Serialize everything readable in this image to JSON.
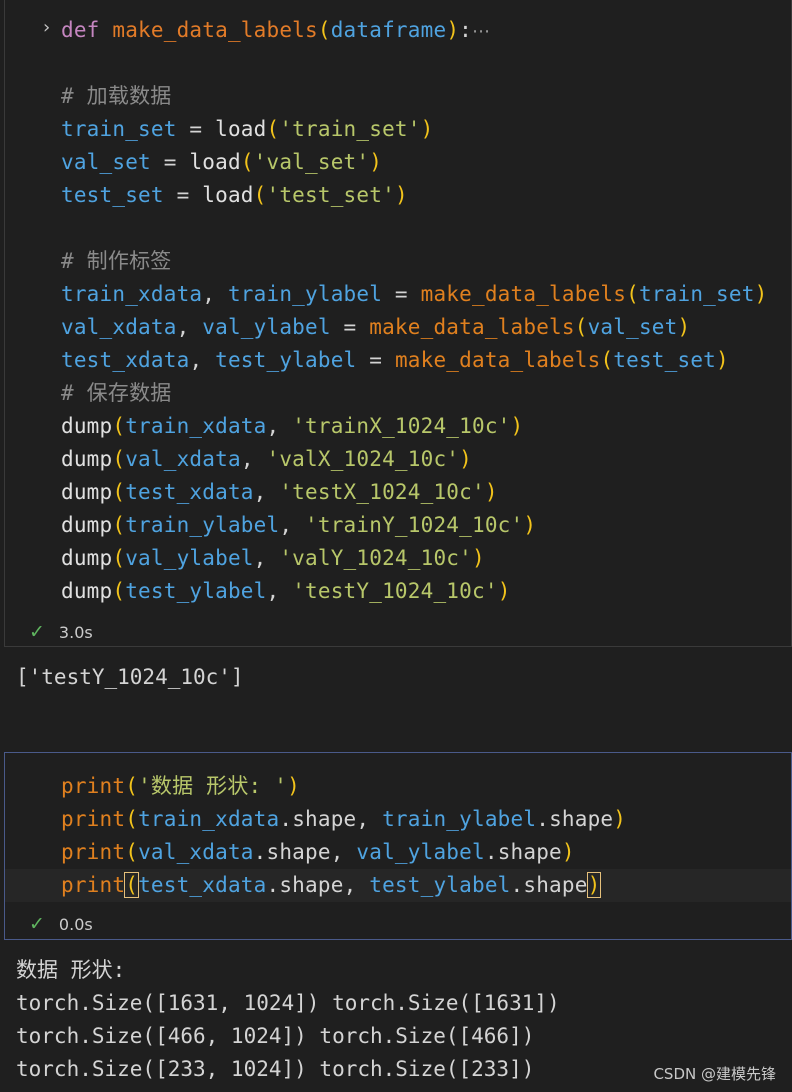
{
  "cell1": {
    "folded_def": {
      "kw": "def",
      "name": "make_data_labels",
      "param": "dataframe",
      "colon": ":",
      "ellipsis": "⋯"
    },
    "comment_load": "# 加载数据",
    "load_lines": [
      {
        "var": "train_set",
        "fn": "load",
        "arg": "'train_set'"
      },
      {
        "var": "val_set",
        "fn": "load",
        "arg": "'val_set'"
      },
      {
        "var": "test_set",
        "fn": "load",
        "arg": "'test_set'"
      }
    ],
    "comment_labels": "# 制作标签",
    "label_lines": [
      {
        "a": "train_xdata",
        "b": "train_ylabel",
        "fn": "make_data_labels",
        "arg": "train_set"
      },
      {
        "a": "val_xdata",
        "b": "val_ylabel",
        "fn": "make_data_labels",
        "arg": "val_set"
      },
      {
        "a": "test_xdata",
        "b": "test_ylabel",
        "fn": "make_data_labels",
        "arg": "test_set"
      }
    ],
    "comment_save": "# 保存数据",
    "dump_lines": [
      {
        "fn": "dump",
        "var": "train_xdata",
        "arg": "'trainX_1024_10c'"
      },
      {
        "fn": "dump",
        "var": "val_xdata",
        "arg": "'valX_1024_10c'"
      },
      {
        "fn": "dump",
        "var": "test_xdata",
        "arg": "'testX_1024_10c'"
      },
      {
        "fn": "dump",
        "var": "train_ylabel",
        "arg": "'trainY_1024_10c'"
      },
      {
        "fn": "dump",
        "var": "val_ylabel",
        "arg": "'valY_1024_10c'"
      },
      {
        "fn": "dump",
        "var": "test_ylabel",
        "arg": "'testY_1024_10c'"
      }
    ],
    "status_time": "3.0s",
    "output": "['testY_1024_10c']"
  },
  "cell2": {
    "line0": {
      "fn": "print",
      "arg": "'数据 形状: '"
    },
    "shape_lines": [
      {
        "fn": "print",
        "a": "train_xdata",
        "b": "train_ylabel"
      },
      {
        "fn": "print",
        "a": "val_xdata",
        "b": "val_ylabel"
      },
      {
        "fn": "print",
        "a": "test_xdata",
        "b": "test_ylabel"
      }
    ],
    "attr": "shape",
    "status_time": "0.0s",
    "output": [
      "数据 形状:",
      "torch.Size([1631, 1024]) torch.Size([1631])",
      "torch.Size([466, 1024]) torch.Size([466])",
      "torch.Size([233, 1024]) torch.Size([233])"
    ]
  },
  "watermark": "CSDN @建模先锋",
  "colors": {
    "background": "#1f1f1f",
    "keyword": "#c586c0",
    "function": "#e0801f",
    "variable": "#4fa3e0",
    "string": "#b8c76a",
    "bracket": "#f2c31b",
    "comment": "#8a8a8a",
    "success": "#5fb55f"
  }
}
